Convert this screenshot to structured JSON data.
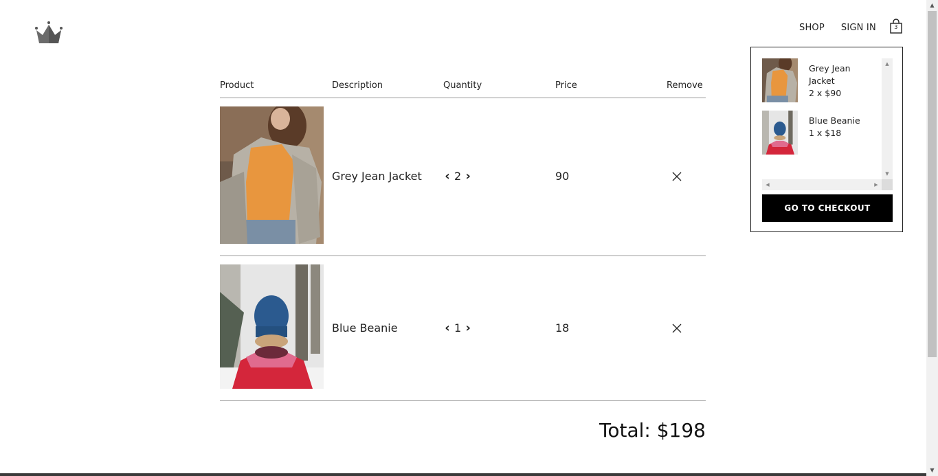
{
  "header": {
    "logo": "crown-icon",
    "nav": {
      "shop_label": "SHOP",
      "signin_label": "SIGN IN",
      "bag_icon": "shopping-bag-icon",
      "bag_count": "3"
    }
  },
  "cart_table": {
    "headers": {
      "product": "Product",
      "description": "Description",
      "quantity": "Quantity",
      "price": "Price",
      "remove": "Remove"
    },
    "rows": [
      {
        "image": "grey-jean-jacket-photo",
        "description": "Grey Jean Jacket",
        "decrease_icon": "chevron-left-icon",
        "quantity": "2",
        "increase_icon": "chevron-right-icon",
        "price": "90",
        "remove_icon": "close-icon"
      },
      {
        "image": "blue-beanie-photo",
        "description": "Blue Beanie",
        "decrease_icon": "chevron-left-icon",
        "quantity": "1",
        "increase_icon": "chevron-right-icon",
        "price": "18",
        "remove_icon": "close-icon"
      }
    ],
    "total": "Total: $198"
  },
  "mini_cart": {
    "items": [
      {
        "name": "Grey Jean Jacket",
        "summary": "2 x $90"
      },
      {
        "name": "Blue Beanie",
        "summary": "1 x $18"
      }
    ],
    "checkout_label": "GO TO CHECKOUT"
  },
  "colors": {
    "text": "#222222",
    "button_bg": "#000000",
    "button_text": "#ffffff",
    "divider": "#999999"
  }
}
